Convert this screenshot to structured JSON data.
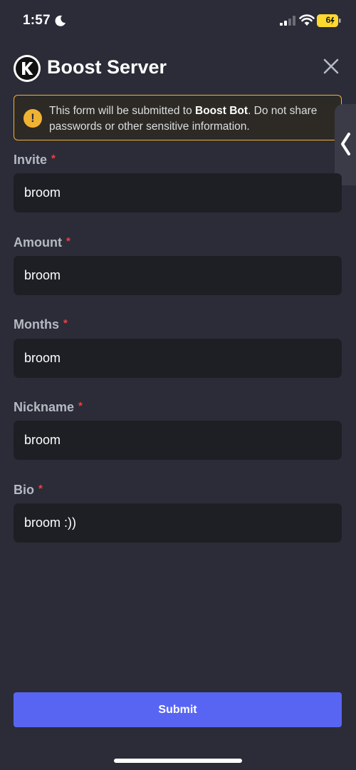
{
  "status_bar": {
    "time": "1:57",
    "battery": "6"
  },
  "header": {
    "title": "Boost Server"
  },
  "warning": {
    "prefix": "This form will be submitted to ",
    "bot_name": "Boost Bot",
    "suffix": ". Do not share passwords or other sensitive information."
  },
  "fields": [
    {
      "label": "Invite",
      "required": "*",
      "value": "broom"
    },
    {
      "label": "Amount",
      "required": "*",
      "value": "broom"
    },
    {
      "label": "Months",
      "required": "*",
      "value": "broom"
    },
    {
      "label": "Nickname",
      "required": "*",
      "value": "broom"
    },
    {
      "label": "Bio",
      "required": "*",
      "value": "broom :))"
    }
  ],
  "submit": {
    "label": "Submit"
  },
  "colors": {
    "background": "#2b2c38",
    "input_background": "#1e1f25",
    "accent": "#5865f2",
    "warning": "#f0b232",
    "required": "#f23f42"
  }
}
